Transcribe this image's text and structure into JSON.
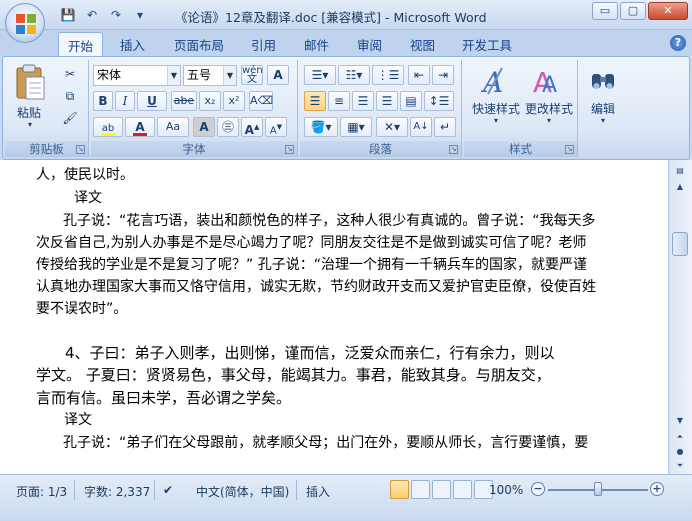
{
  "window": {
    "title": "《论语》12章及翻译.doc [兼容模式] - Microsoft Word",
    "min_glyph": "▭",
    "max_glyph": "▢",
    "close_glyph": "✕"
  },
  "qat": {
    "save": "💾",
    "undo": "↶",
    "redo": "↷",
    "more": "▾"
  },
  "tabs": [
    "开始",
    "插入",
    "页面布局",
    "引用",
    "邮件",
    "审阅",
    "视图",
    "开发工具"
  ],
  "help_glyph": "?",
  "ribbon": {
    "clipboard": {
      "paste": "粘贴",
      "label": "剪贴板"
    },
    "font": {
      "name": "宋体",
      "size": "五号",
      "label": "字体",
      "bold": "B",
      "italic": "I",
      "underline": "U",
      "strike": "abe",
      "sub": "x₂",
      "sup": "x²",
      "aa": "Aa",
      "char_border": "A",
      "grow": "A",
      "shrink": "A",
      "wen": "文"
    },
    "paragraph": {
      "label": "段落"
    },
    "styles": {
      "quick": "快速样式",
      "change": "更改样式",
      "label": "样式"
    },
    "editing": {
      "label": "编辑"
    }
  },
  "document": {
    "lines": [
      "人，使民以时。",
      "译文",
      "孔子说：“花言巧语，装出和颜悦色的样子，这种人很少有真诚的。曾子说：“我每天多",
      "次反省自己,为别人办事是不是尽心竭力了呢？同朋友交往是不是做到诚实可信了呢？老师",
      "传授给我的学业是不是复习了呢？” 孔子说：“治理一个拥有一千辆兵车的国家，就要严谨",
      "认真地办理国家大事而又恪守信用，诚实无欺，节约财政开支而又爱护官吏臣僚，役使百姓",
      "要不误农时”。",
      "4、子曰：弟子入则孝，出则悌，谨而信，泛爱众而亲仁，行有余力，则以",
      "学文。  子夏曰：贤贤易色，事父母，能竭其力。事君，能致其身。与朋友交，",
      "言而有信。虽曰未学，吾必谓之学矣。",
      "译文",
      "孔子说：“弟子们在父母跟前，就孝顺父母；出门在外，要顺从师长，言行要谨慎，要"
    ]
  },
  "status": {
    "page": "页面: 1/3",
    "words": "字数: 2,337",
    "lang": "中文(简体，中国)",
    "mode": "插入",
    "zoom": "100%",
    "zoom_minus": "−",
    "zoom_plus": "+"
  }
}
